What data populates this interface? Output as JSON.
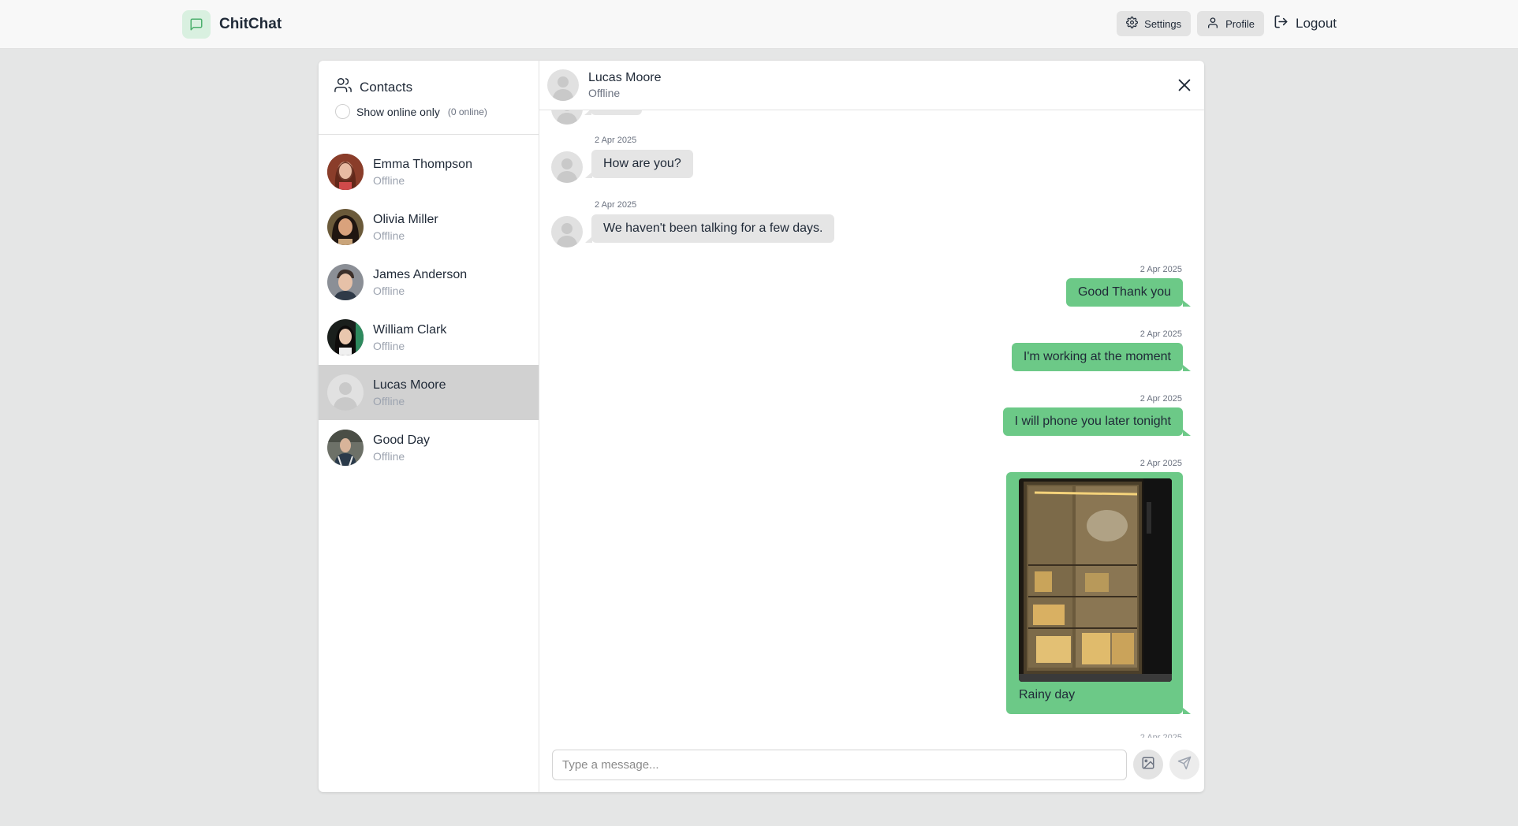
{
  "app": {
    "name": "ChitChat",
    "brand_color": "#6cc987"
  },
  "navbar": {
    "settings_label": "Settings",
    "profile_label": "Profile",
    "logout_label": "Logout"
  },
  "sidebar": {
    "title": "Contacts",
    "filter_label": "Show online only",
    "online_count": "(0 online)",
    "contacts": [
      {
        "name": "Emma Thompson",
        "status": "Offline"
      },
      {
        "name": "Olivia Miller",
        "status": "Offline"
      },
      {
        "name": "James Anderson",
        "status": "Offline"
      },
      {
        "name": "William Clark",
        "status": "Offline"
      },
      {
        "name": "Lucas Moore",
        "status": "Offline",
        "selected": true
      },
      {
        "name": "Good Day",
        "status": "Offline"
      }
    ]
  },
  "chat": {
    "contact_name": "Lucas Moore",
    "contact_status": "Offline",
    "messages": [
      {
        "direction": "in",
        "time": "2 Apr 2025",
        "text": "How are you?"
      },
      {
        "direction": "in",
        "time": "2 Apr 2025",
        "text": "We haven't been talking for a few days."
      },
      {
        "direction": "out",
        "time": "2 Apr 2025",
        "text": "Good Thank you"
      },
      {
        "direction": "out",
        "time": "2 Apr 2025",
        "text": "I'm working at the moment"
      },
      {
        "direction": "out",
        "time": "2 Apr 2025",
        "text": "I will phone you later tonight"
      },
      {
        "direction": "out",
        "time": "2 Apr 2025",
        "text": "Rainy day",
        "has_image": true
      }
    ],
    "composer_placeholder": "Type a message..."
  }
}
